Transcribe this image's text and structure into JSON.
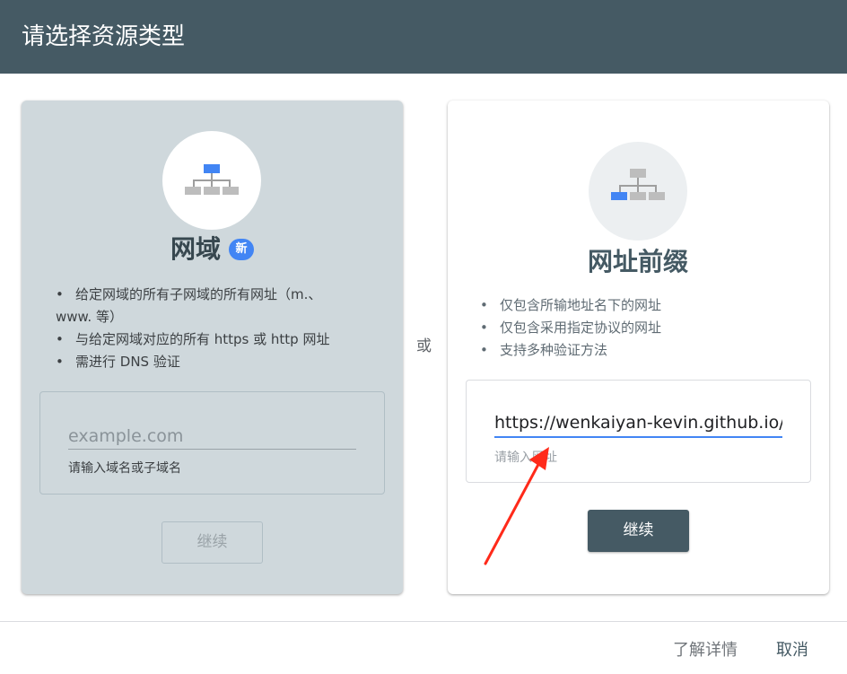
{
  "dialog": {
    "title": "请选择资源类型"
  },
  "domain_card": {
    "title": "网域",
    "badge": "新",
    "features": [
      "给定网域的所有子网域的所有网址（m.、",
      "www. 等）",
      "与给定网域对应的所有 https 或 http 网址",
      "需进行 DNS 验证"
    ],
    "input_placeholder": "example.com",
    "input_value": "",
    "helper": "请输入域名或子域名",
    "continue_label": "继续",
    "continue_enabled": false
  },
  "or_label": "或",
  "url_card": {
    "title": "网址前缀",
    "features": [
      "仅包含所输地址名下的网址",
      "仅包含采用指定协议的网址",
      "支持多种验证方法"
    ],
    "input_value": "https://wenkaiyan-kevin.github.io/",
    "helper": "请输入网址",
    "continue_label": "继续",
    "continue_enabled": true
  },
  "footer": {
    "learn_more": "了解详情",
    "cancel": "取消"
  },
  "colors": {
    "header": "#455a64",
    "accent": "#4285f4",
    "annotation_arrow": "#ff2a1a"
  }
}
